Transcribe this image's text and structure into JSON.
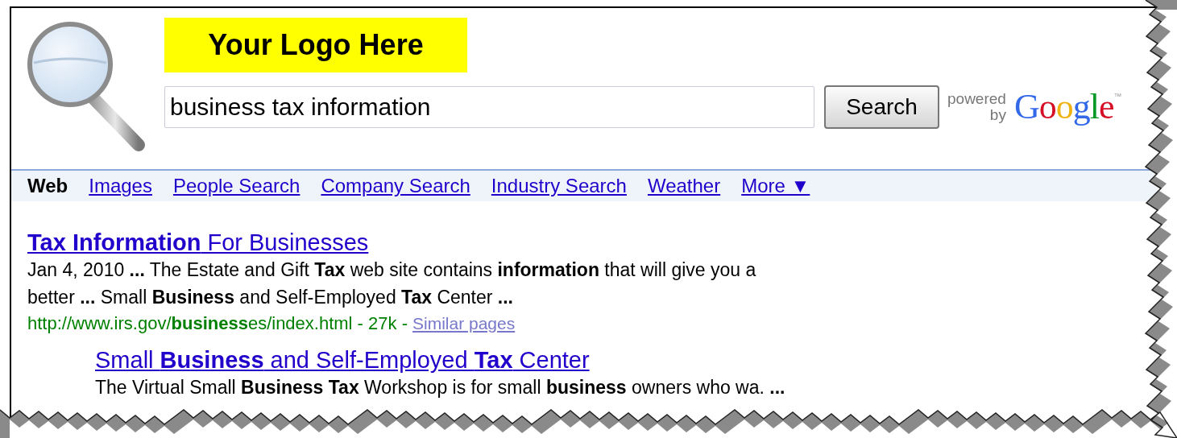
{
  "logo": {
    "text": "Your Logo Here"
  },
  "search": {
    "value": "business tax information",
    "button": "Search"
  },
  "powered_by": {
    "powered": "powered",
    "by": "by",
    "brand": "Google",
    "tm": "™"
  },
  "tabs": [
    {
      "label": "Web",
      "selected": true
    },
    {
      "label": "Images",
      "selected": false
    },
    {
      "label": "People Search",
      "selected": false
    },
    {
      "label": "Company Search",
      "selected": false
    },
    {
      "label": "Industry Search",
      "selected": false
    },
    {
      "label": "Weather",
      "selected": false
    },
    {
      "label": "More",
      "caret": "▼",
      "selected": false
    }
  ],
  "results": [
    {
      "kind": "main",
      "title": "**Tax Information** For Businesses",
      "snippet": [
        "Jan 4, 2010 **...** The Estate and Gift **Tax** web site contains **information** that will give you a",
        "better **...** Small **Business** and Self-Employed **Tax** Center **...**"
      ],
      "url": "http://www.irs.gov/**business**es/index.html - 27k -",
      "similar": "Similar pages"
    },
    {
      "kind": "indented",
      "title": "Small **Business** and Self-Employed **Tax** Center",
      "snippet": [
        "The Virtual Small **Business Tax** Workshop is for small **business** owners who wa. **...**"
      ]
    }
  ]
}
